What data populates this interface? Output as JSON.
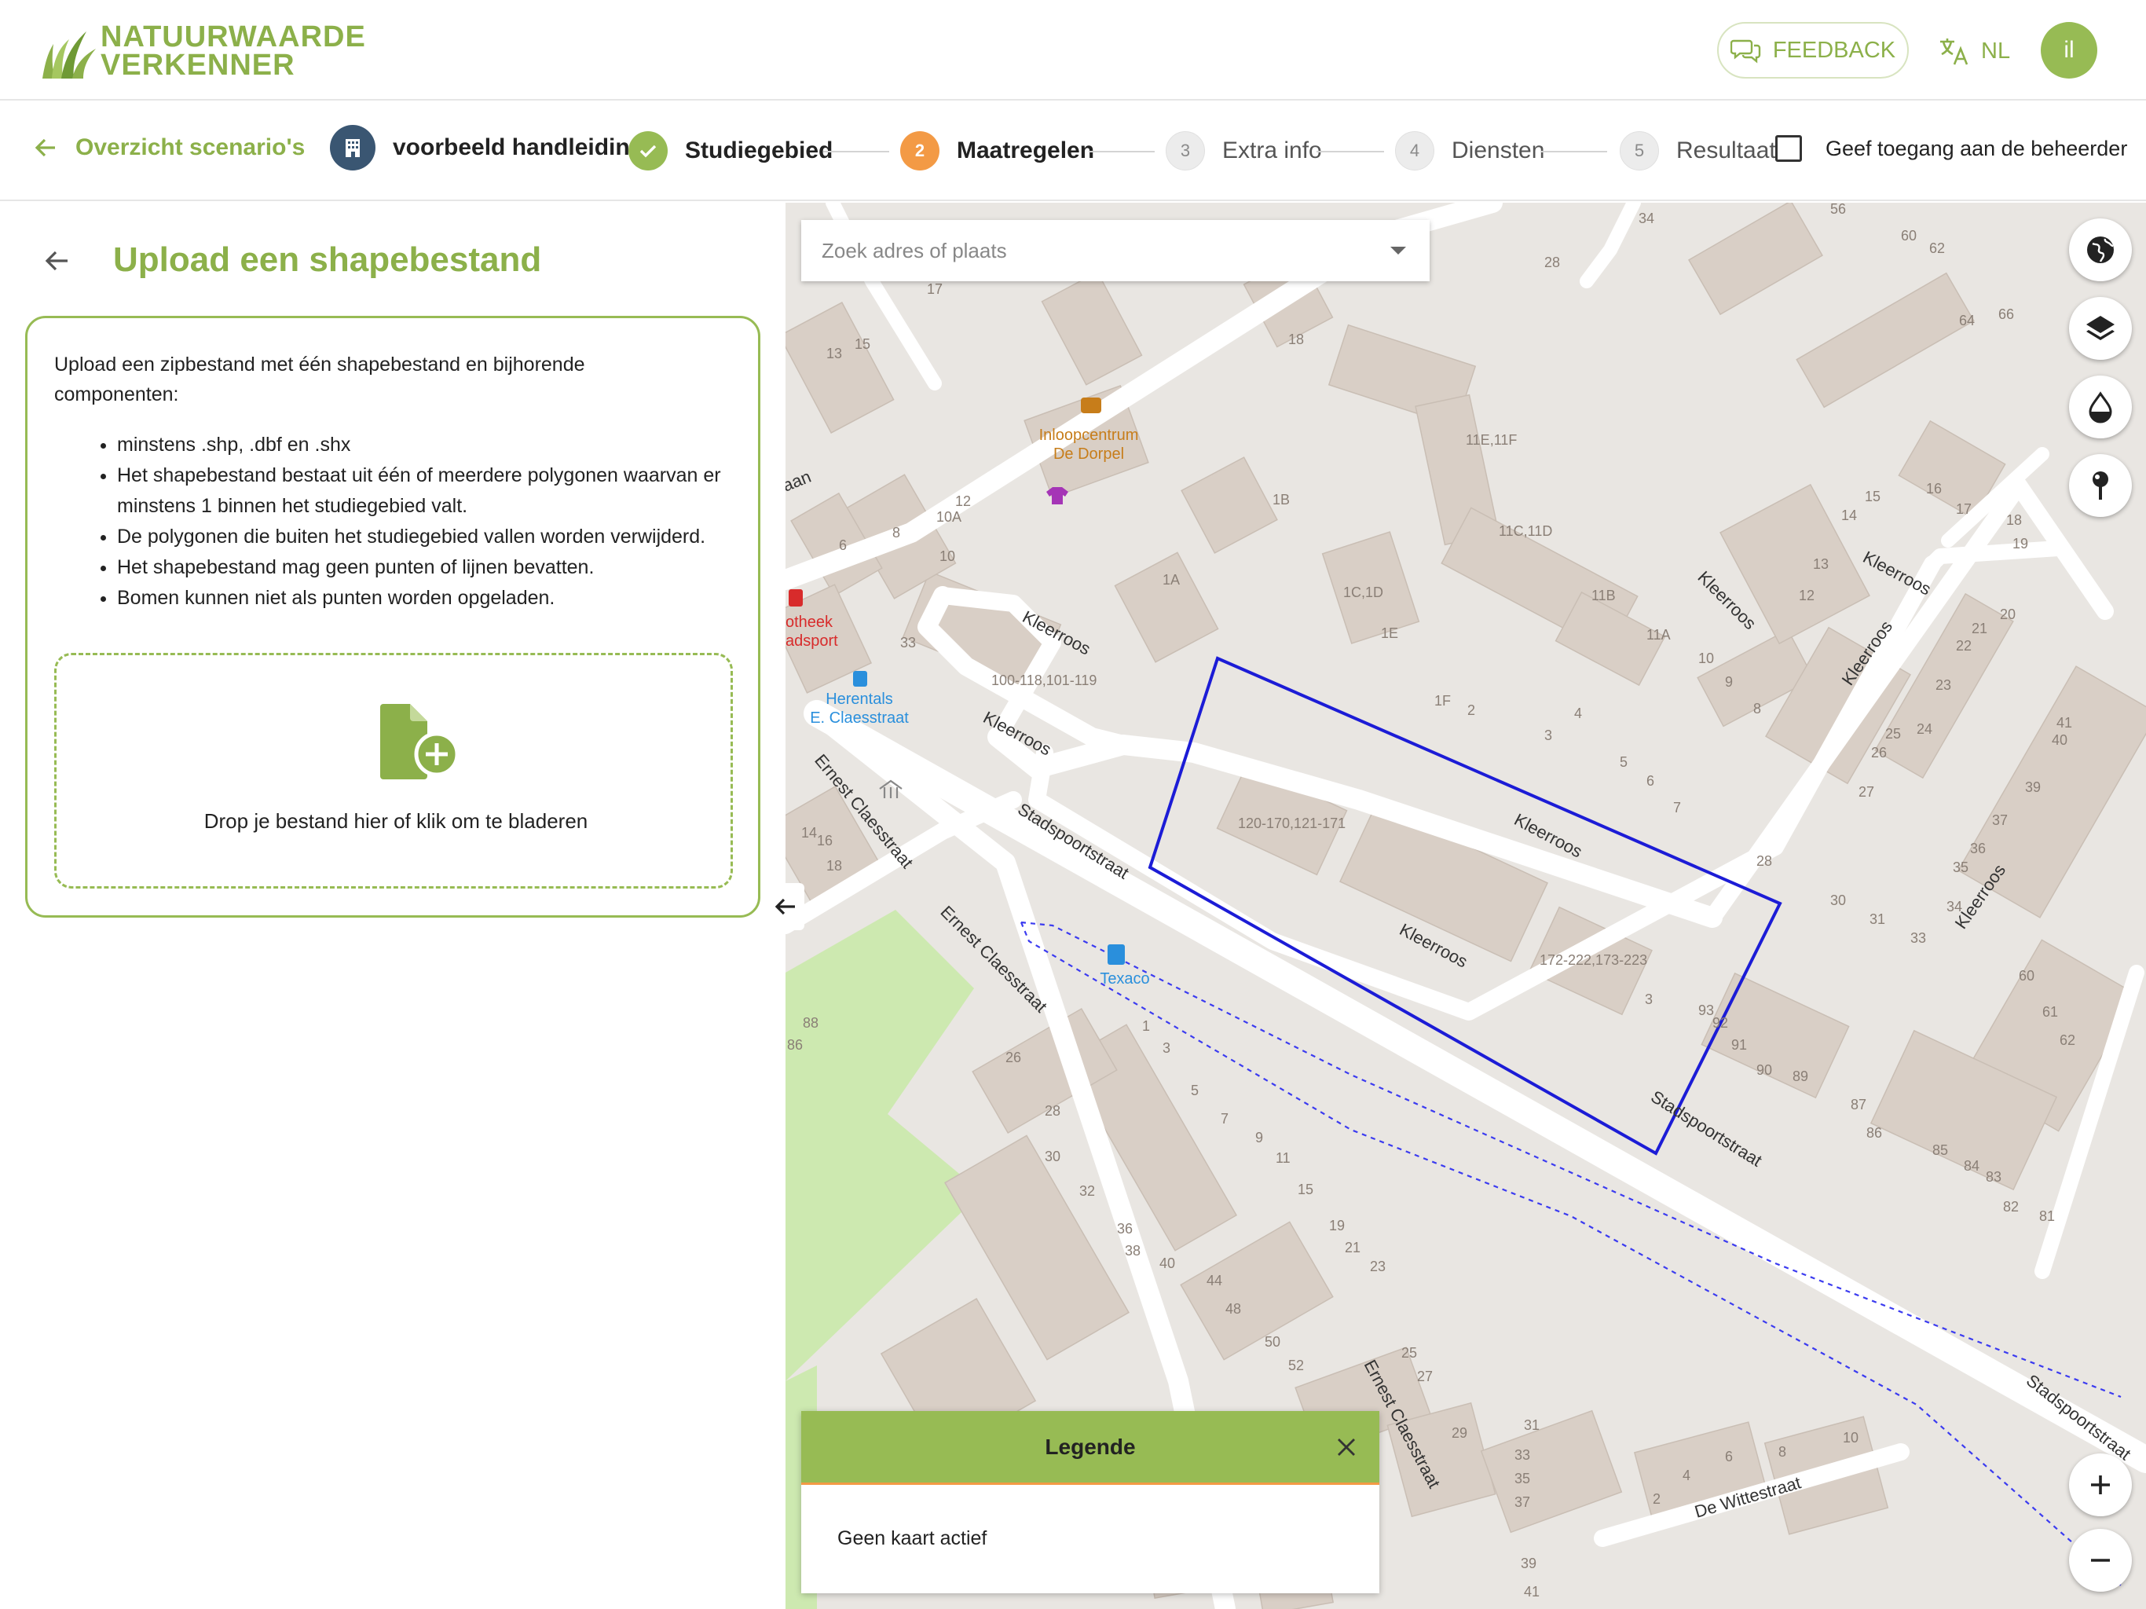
{
  "header": {
    "logo_line1": "NATUURWAARDE",
    "logo_line2": "VERKENNER",
    "feedback_label": "FEEDBACK",
    "language": "NL",
    "avatar_initials": "il"
  },
  "steps": {
    "back_label": "Overzicht scenario's",
    "scenario_name": "voorbeeld handleiding",
    "items": [
      {
        "number": "",
        "label": "Studiegebied",
        "state": "done"
      },
      {
        "number": "2",
        "label": "Maatregelen",
        "state": "active"
      },
      {
        "number": "3",
        "label": "Extra info",
        "state": "todo"
      },
      {
        "number": "4",
        "label": "Diensten",
        "state": "todo"
      },
      {
        "number": "5",
        "label": "Resultaat",
        "state": "todo"
      }
    ],
    "access_label": "Geef toegang aan de beheerder",
    "access_checked": false
  },
  "panel": {
    "title": "Upload een shapebestand",
    "intro": "Upload een zipbestand met één shapebestand en bijhorende componenten:",
    "bullets": [
      "minstens .shp, .dbf en .shx",
      "Het shapebestand bestaat uit één of meerdere polygonen waarvan er minstens 1 binnen het studiegebied valt.",
      "De polygonen die buiten het studiegebied vallen worden verwijderd.",
      "Het shapebestand mag geen punten of lijnen bevatten.",
      "Bomen kunnen niet als punten worden opgeladen."
    ],
    "dropzone_text": "Drop je bestand hier of klik om te bladeren"
  },
  "map": {
    "search_placeholder": "Zoek adres of plaats",
    "legend_title": "Legende",
    "legend_empty": "Geen kaart actief",
    "controls": [
      "globe-icon",
      "layers-icon",
      "drop-icon",
      "pin-icon"
    ],
    "zoom_in": "+",
    "zoom_out": "−",
    "poi": {
      "cafe_line1": "Inloopcentrum",
      "cafe_line2": "De Dorpel",
      "bus_line1": "Herentals",
      "bus_line2": "E. Claesstraat",
      "pharmacy_line1": "otheek",
      "pharmacy_line2": "adsport",
      "fuel": "Texaco"
    },
    "streets": {
      "kleerroos": "Kleerroos",
      "stadspoortstraat": "Stadspoortstraat",
      "ernest": "Ernest Claesstraat",
      "wittestraat": "De Wittestraat",
      "laan": "aan"
    },
    "house_numbers": {
      "b1": "100-118,101-119",
      "b2": "120-170,121-171",
      "b3": "172-222,173-223",
      "n_11e": "11E,11F",
      "n_11c": "11C,11D",
      "n_1c": "1C,1D",
      "n_1b": "1B",
      "n_1a": "1A",
      "n_1e": "1E",
      "n_1f": "1F",
      "n_11b": "11B",
      "n_11a": "11A",
      "n_10a": "10A",
      "n_18": "18",
      "n_12": "12",
      "n_10": "10",
      "n_8": "8",
      "n_6": "6",
      "n_33": "33",
      "n_13": "13",
      "n_15": "15",
      "n_17": "17",
      "n_22": "22",
      "n_28": "28",
      "n_34": "34",
      "n_56": "56",
      "n_60": "60",
      "n_62": "62",
      "n_64": "64",
      "n_66": "66",
      "n_16": "16",
      "n_14": "14",
      "n_19": "19",
      "n_20": "20",
      "n_23": "23",
      "n_24": "24",
      "n_25": "25",
      "n_26": "26",
      "n_27": "27",
      "n_30": "30",
      "n_31": "31",
      "n_35": "35",
      "n_36": "36",
      "n_37": "37",
      "n_39": "39",
      "n_40": "40",
      "n_41": "41",
      "n_88": "88",
      "n_86": "86",
      "n_92": "92",
      "n_91": "91",
      "n_90": "90",
      "n_89": "89",
      "n_87": "87",
      "n_85": "85",
      "n_84": "84",
      "n_83": "83",
      "n_82": "82",
      "n_81": "81",
      "n_61": "61",
      "n_3": "3",
      "n_4": "4",
      "n_5": "5",
      "n_7": "7",
      "n_9": "9",
      "n_11": "11",
      "n_21": "21",
      "n_29": "29",
      "n_32": "32",
      "n_38": "38",
      "n_44": "44",
      "n_48": "48",
      "n_50": "50",
      "n_52": "52",
      "n_1": "1",
      "n_2": "2",
      "n_93": "93"
    }
  },
  "colors": {
    "brand_green": "#8cb04a",
    "accent_orange": "#f39a45",
    "scenario_navy": "#3a5672",
    "polygon_blue": "#1c1cd6"
  }
}
